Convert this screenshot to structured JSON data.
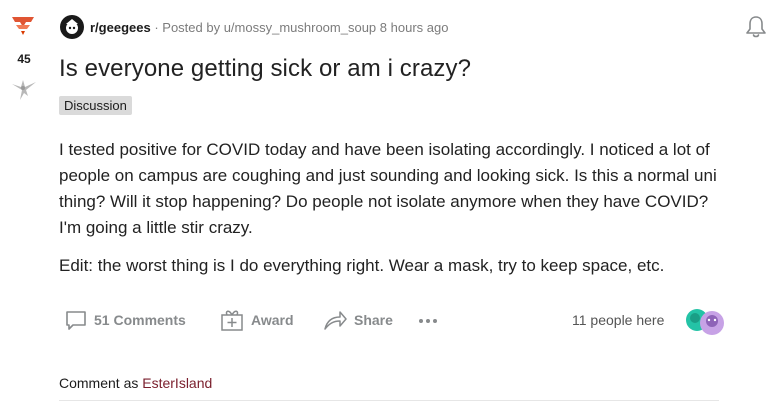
{
  "vote": {
    "score": "45"
  },
  "post": {
    "subreddit": "r/geegees",
    "posted_by": "· Posted by u/mossy_mushroom_soup",
    "time_ago": "8 hours ago",
    "title": "Is everyone getting sick or am i crazy?",
    "flair": "Discussion",
    "body": [
      "I tested positive for COVID today and have been isolating accordingly. I noticed a lot of people on campus are coughing and just sounding and looking sick. Is this a normal uni thing? Will it stop happening? Do people not isolate anymore when they have COVID? I'm going a little stir crazy.",
      "Edit: the worst thing is I do everything right. Wear a mask, try to keep space, etc."
    ]
  },
  "actions": {
    "comments_label": "51 Comments",
    "award_label": "Award",
    "share_label": "Share",
    "here_label": "11 people here"
  },
  "comment_box": {
    "prefix": "Comment as",
    "username": "EsterIsland"
  },
  "colors": {
    "upvote": "#d93a00",
    "username": "#7a1e2c",
    "action_gray": "#878a8c",
    "flair_bg": "#dadada"
  },
  "icons": [
    "upvote-icon",
    "downvote-icon",
    "subreddit-avatar-icon",
    "notification-bell-icon",
    "comment-icon",
    "award-icon",
    "share-icon",
    "more-options-icon"
  ]
}
